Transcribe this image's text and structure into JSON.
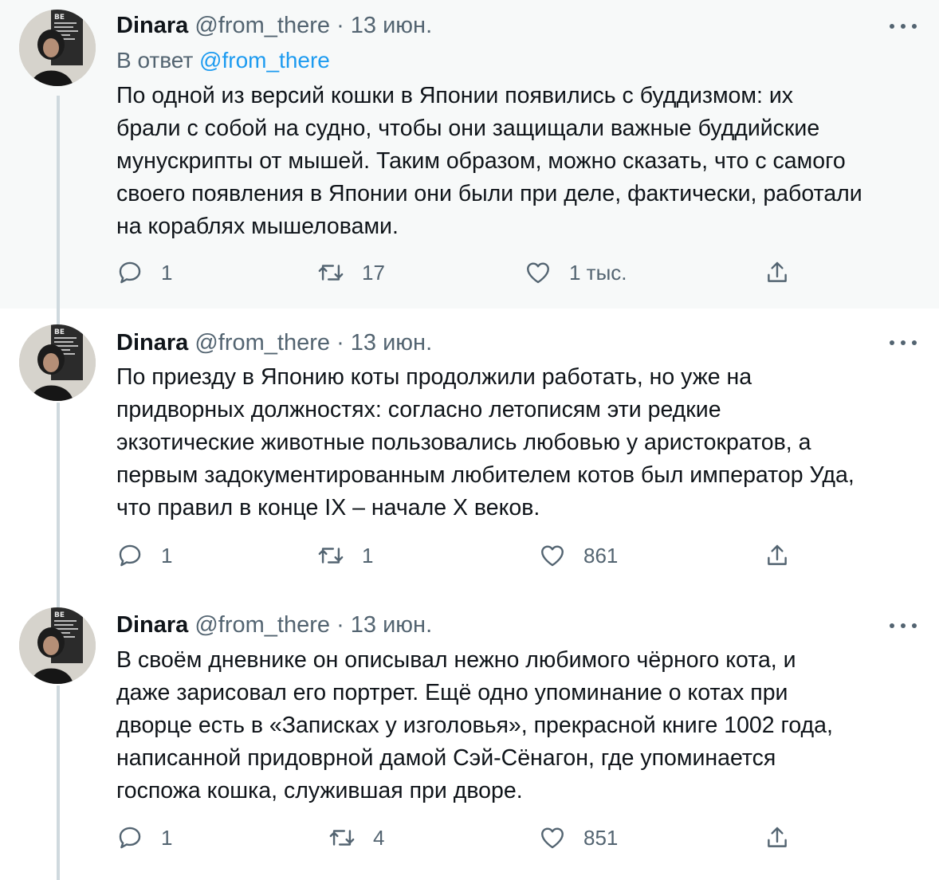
{
  "tweets": [
    {
      "name": "Dinara",
      "handle": "@from_there",
      "separator": "·",
      "date": "13 июн.",
      "reply_prefix": "В ответ",
      "reply_handle": "@from_there",
      "text": "По одной из версий кошки в Японии появились с буддизмом: их\nбрали с собой на судно, чтобы они защищали важные буддийские\nмунускрипты от мышей. Таким образом, можно сказать, что с самого\nсвоего появления в Японии они были при деле, фактически, работали\nна кораблях мышеловами.",
      "replies": "1",
      "retweets": "17",
      "likes": "1 тыс."
    },
    {
      "name": "Dinara",
      "handle": "@from_there",
      "separator": "·",
      "date": "13 июн.",
      "text": "По приезду в Японию коты продолжили работать, но уже на\nпридворных должностях: согласно летописям эти редкие\nэкзотические животные пользовались любовью у аристократов, а\nпервым задокументированным любителем котов был император Уда,\nчто правил в конце IX – начале X веков.",
      "replies": "1",
      "retweets": "1",
      "likes": "861"
    },
    {
      "name": "Dinara",
      "handle": "@from_there",
      "separator": "·",
      "date": "13 июн.",
      "text": "В своём дневнике он описывал нежно любимого чёрного кота, и\nдаже зарисовал его портрет. Ещё одно упоминание о котах при\nдворце есть в «Записках у изголовья», прекрасной книге 1002 года,\nнаписанной придоврной дамой Сэй-Сёнагон, где упоминается\nгоспожа кошка, служившая при дворе.",
      "replies": "1",
      "retweets": "4",
      "likes": "851"
    }
  ],
  "icons": {
    "reply": "reply-icon",
    "retweet": "retweet-icon",
    "like": "heart-icon",
    "share": "share-icon",
    "more": "more-icon"
  },
  "colors": {
    "link": "#1d9bf0",
    "secondary_text": "#536471",
    "highlight_background": "#f7f9f9",
    "thread_line": "#cfd9de"
  },
  "avatar_text": "BE IN THIS HOUSE WE ARE FAMILY LOVE LAUGH"
}
